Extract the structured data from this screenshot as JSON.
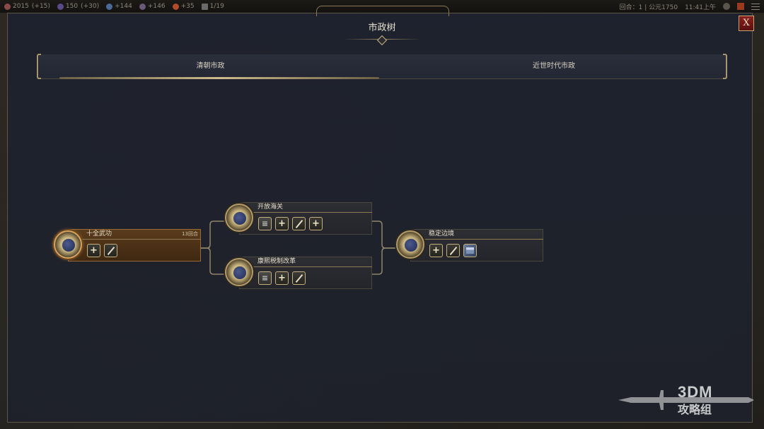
{
  "topbar": {
    "resources": [
      {
        "value": "2015",
        "delta": "(+15)",
        "icon": "science-icon",
        "color": "#8a4a4a"
      },
      {
        "value": "150",
        "delta": "(+30)",
        "icon": "culture-icon",
        "color": "#5a4a8a"
      },
      {
        "value": "+144",
        "delta": "",
        "icon": "faith-icon",
        "color": "#4a6a9a"
      },
      {
        "value": "+146",
        "delta": "",
        "icon": "music-icon",
        "color": "#6a5a7a"
      },
      {
        "value": "+35",
        "delta": "",
        "icon": "gold-icon",
        "color": "#b04a2a"
      },
      {
        "value": "1/19",
        "delta": "",
        "icon": "great-people-icon",
        "color": "#6a6a6a"
      }
    ],
    "turn": "回合：1 | 公元1750",
    "time": "11:41上午"
  },
  "panel": {
    "title": "市政树",
    "close_label": "X",
    "tabs": [
      {
        "label": "清朝市政",
        "active": true
      },
      {
        "label": "近世时代市政",
        "active": false
      }
    ]
  },
  "tree": {
    "nodes": [
      {
        "id": "n1",
        "name": "十全武功",
        "turns": "13回合",
        "active": true,
        "unlocks": [
          {
            "kind": "plus",
            "glyph": "+"
          },
          {
            "kind": "diag",
            "glyph": ""
          }
        ]
      },
      {
        "id": "n2",
        "name": "开放海关",
        "turns": "",
        "active": false,
        "unlocks": [
          {
            "kind": "gray",
            "glyph": "≡"
          },
          {
            "kind": "plus",
            "glyph": "+"
          },
          {
            "kind": "diag",
            "glyph": ""
          },
          {
            "kind": "plus",
            "glyph": "+"
          }
        ]
      },
      {
        "id": "n3",
        "name": "康熙税制改革",
        "turns": "",
        "active": false,
        "unlocks": [
          {
            "kind": "gray",
            "glyph": "≡"
          },
          {
            "kind": "plus",
            "glyph": "+"
          },
          {
            "kind": "diag",
            "glyph": ""
          }
        ]
      },
      {
        "id": "n4",
        "name": "稳定边境",
        "turns": "",
        "active": false,
        "unlocks": [
          {
            "kind": "plus",
            "glyph": "+"
          },
          {
            "kind": "diag",
            "glyph": ""
          },
          {
            "kind": "pic",
            "glyph": ""
          }
        ]
      }
    ]
  },
  "watermark": {
    "brand": "3DM",
    "sub": "攻略组"
  }
}
